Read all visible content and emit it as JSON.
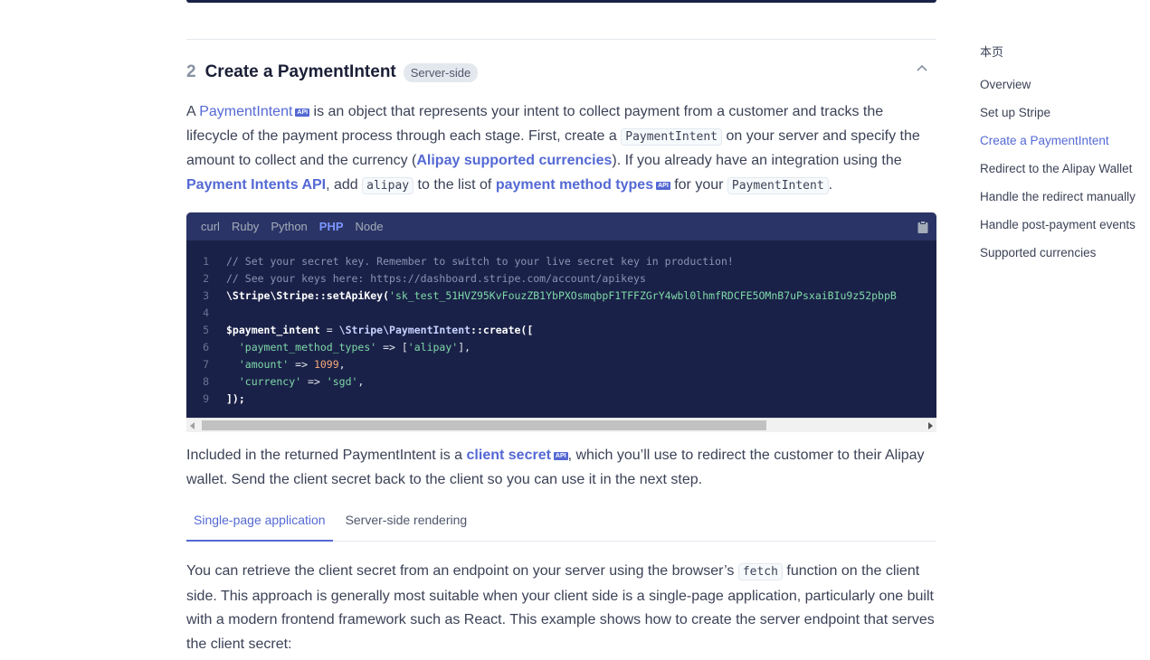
{
  "step": {
    "number": "2",
    "title": "Create a PaymentIntent",
    "badge": "Server-side"
  },
  "intro": {
    "t1": "A ",
    "link_paymentintent": "PaymentIntent",
    "api": "API",
    "t2": " is an object that represents your intent to collect payment from a customer and tracks the lifecycle of the payment process through each stage. First, create a ",
    "code_paymentintent": "PaymentIntent",
    "t3": " on your server and specify the amount to collect and the currency (",
    "link_currencies": "Alipay supported currencies",
    "t4": "). If you already have an integration using the ",
    "link_pi_api": "Payment Intents API",
    "t5": ", add ",
    "code_alipay": "alipay",
    "t6": " to the list of ",
    "link_pm_types": "payment method types",
    "t7": " for your ",
    "code_paymentintent2": "PaymentIntent",
    "t8": "."
  },
  "code": {
    "languages": [
      "curl",
      "Ruby",
      "Python",
      "PHP",
      "Node"
    ],
    "active_language": "PHP",
    "lines": {
      "l1": "// Set your secret key. Remember to switch to your live secret key in production!",
      "l2": "// See your keys here: https://dashboard.stripe.com/account/apikeys",
      "l3a": "\\Stripe\\Stripe::setApiKey(",
      "l3b": "'sk_test_51HVZ95KvFouzZB1YbPXOsmqbpF1TFFZGrY4wbl0lhmfRDCFE5OMnB7uPsxaiBIu9z52pbpB",
      "l5a": "$payment_intent",
      "l5b": " = ",
      "l5c": "\\Stripe\\PaymentIntent",
      "l5d": "::create([",
      "l6a": "  'payment_method_types'",
      "l6b": " => [",
      "l6c": "'alipay'",
      "l6d": "],",
      "l7a": "  'amount'",
      "l7b": " => ",
      "l7c": "1099",
      "l7d": ",",
      "l8a": "  'currency'",
      "l8b": " => ",
      "l8c": "'sgd'",
      "l8d": ",",
      "l9": "]);"
    },
    "line_numbers": [
      "1",
      "2",
      "3",
      "4",
      "5",
      "6",
      "7",
      "8",
      "9"
    ]
  },
  "secret_para": {
    "t1": "Included in the returned PaymentIntent is a ",
    "link": "client secret",
    "api": "API",
    "t2": ", which you’ll use to redirect the customer to their Alipay wallet. Send the client secret back to the client so you can use it in the next step."
  },
  "tabs": {
    "spa": "Single-page application",
    "ssr": "Server-side rendering"
  },
  "fetch_para": {
    "t1": "You can retrieve the client secret from an endpoint on your server using the browser’s ",
    "code": "fetch",
    "t2": " function on the client side. This approach is generally most suitable when your client side is a single-page application, particularly one built with a modern frontend framework such as React. This example shows how to create the server endpoint that serves the client secret:"
  },
  "toc": {
    "title": "本页",
    "items": [
      "Overview",
      "Set up Stripe",
      "Create a PaymentIntent",
      "Redirect to the Alipay Wallet",
      "Handle the redirect manually",
      "Handle post-payment events",
      "Supported currencies"
    ],
    "active_item": "Create a PaymentIntent"
  },
  "colors": {
    "accent": "#5469d4",
    "code_bg": "#1a2148",
    "code_tabs_bg": "#2b3466",
    "text": "#3c4257"
  }
}
